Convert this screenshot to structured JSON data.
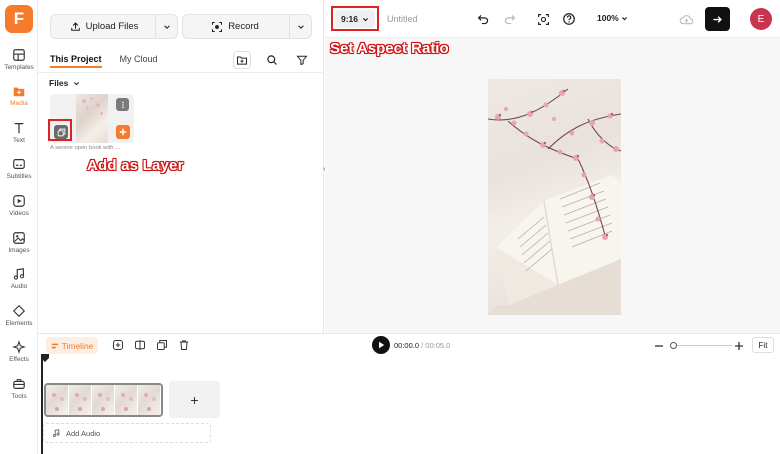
{
  "app": {
    "logo_letter": "F",
    "brand_color": "#f47c2c"
  },
  "sidebar": {
    "items": [
      {
        "label": "Templates",
        "icon": "templates-icon"
      },
      {
        "label": "Media",
        "icon": "media-icon",
        "active": true
      },
      {
        "label": "Text",
        "icon": "text-icon"
      },
      {
        "label": "Subtitles",
        "icon": "subtitles-icon"
      },
      {
        "label": "Videos",
        "icon": "videos-icon"
      },
      {
        "label": "Images",
        "icon": "images-icon"
      },
      {
        "label": "Audio",
        "icon": "audio-icon"
      },
      {
        "label": "Elements",
        "icon": "elements-icon"
      },
      {
        "label": "Effects",
        "icon": "effects-icon"
      },
      {
        "label": "Tools",
        "icon": "tools-icon"
      }
    ]
  },
  "media_panel": {
    "upload_label": "Upload Files",
    "record_label": "Record",
    "tabs": [
      {
        "label": "This Project",
        "active": true
      },
      {
        "label": "My Cloud"
      }
    ],
    "files_label": "Files",
    "file": {
      "caption": "A serene open book with ..."
    }
  },
  "editor": {
    "aspect_ratio": "9:16",
    "project_name": "Untitled",
    "zoom": "100%",
    "avatar_letter": "E"
  },
  "annotations": {
    "aspect": "Set Aspect Ratio",
    "layer": "Add as Layer"
  },
  "timeline": {
    "tab_label": "Timeline",
    "current_time": "00:00.0",
    "total_time": "/ 00:05.0",
    "fit_label": "Fit",
    "add_audio_label": "Add Audio",
    "add_clip_symbol": "+"
  }
}
